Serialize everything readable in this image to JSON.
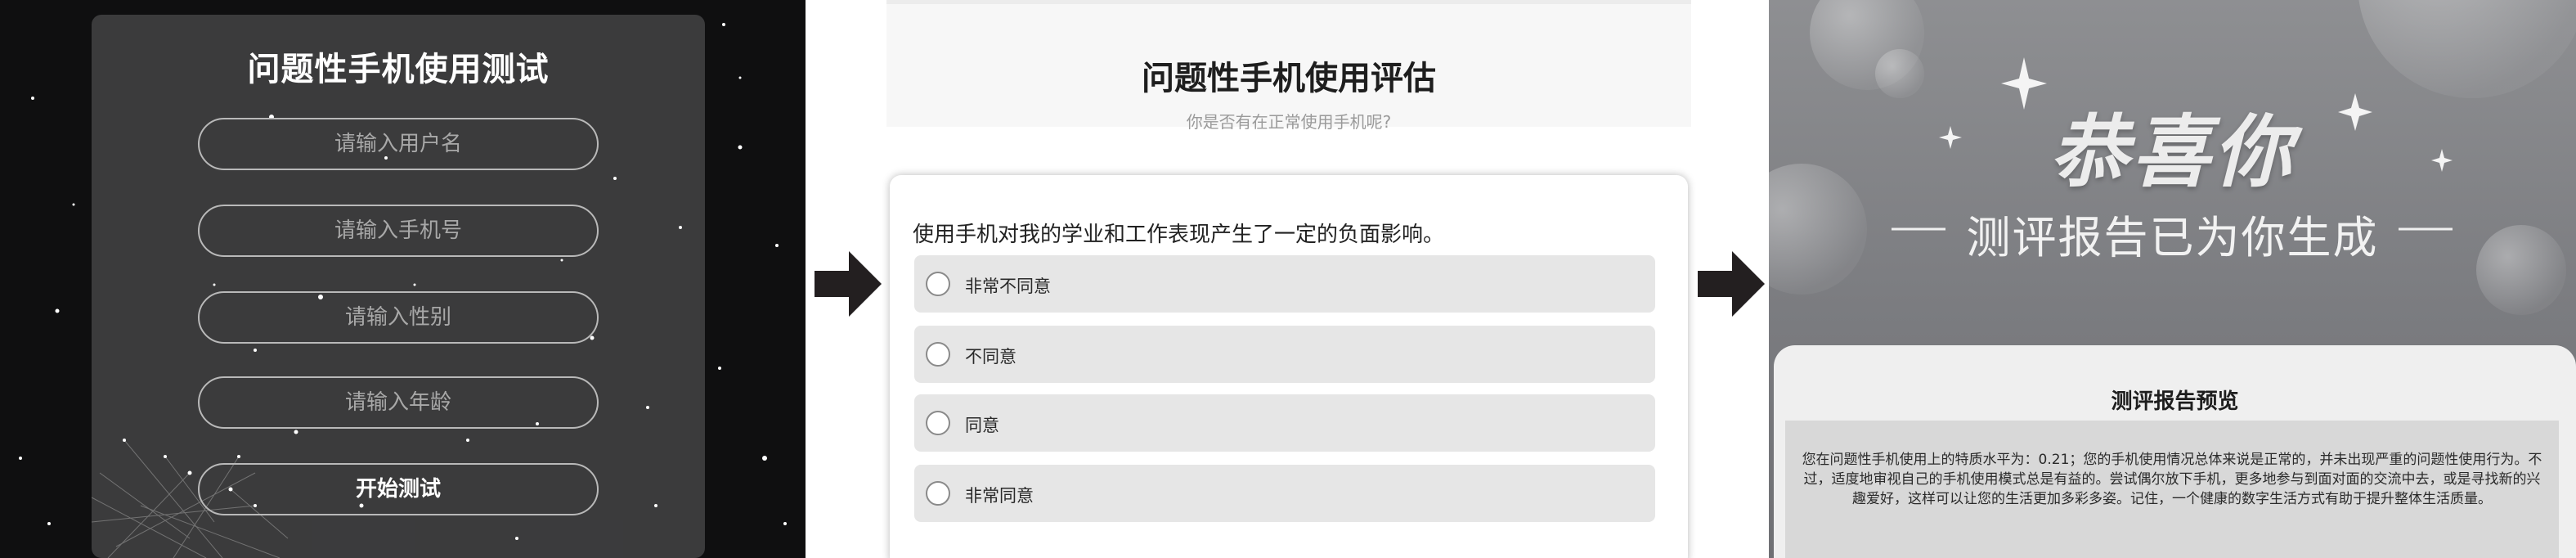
{
  "login": {
    "title": "问题性手机使用测试",
    "fields": [
      {
        "placeholder": "请输入用户名"
      },
      {
        "placeholder": "请输入手机号"
      },
      {
        "placeholder": "请输入性别"
      },
      {
        "placeholder": "请输入年龄"
      }
    ],
    "start_button": "开始测试"
  },
  "survey": {
    "title": "问题性手机使用评估",
    "subtitle": "你是否有在正常使用手机呢?",
    "question": "使用手机对我的学业和工作表现产生了一定的负面影响。",
    "options": [
      "非常不同意",
      "不同意",
      "同意",
      "非常同意"
    ]
  },
  "report": {
    "congrats": "恭喜你",
    "subtitle": "测评报告已为你生成",
    "preview_title": "测评报告预览",
    "summary": "您在问题性手机使用上的特质水平为：0.21；您的手机使用情况总体来说是正常的，并未出现严重的问题性使用行为。不过，适度地审视自己的手机使用模式总是有益的。尝试偶尔放下手机，更多地参与到面对面的交流中去，或是寻找新的兴趣爱好，这样可以让您的生活更加多彩多姿。记住，一个健康的数字生活方式有助于提升整体生活质量。"
  },
  "icons": {
    "flow_arrow": "right-arrow-icon",
    "sparkle": "sparkle-icon"
  },
  "colors": {
    "login_bg": "#0f0f10",
    "login_card": "#3e3e40",
    "arrow": "#231f20",
    "option_bg": "#e6e6e6",
    "report_bg": "#7b7c80"
  }
}
